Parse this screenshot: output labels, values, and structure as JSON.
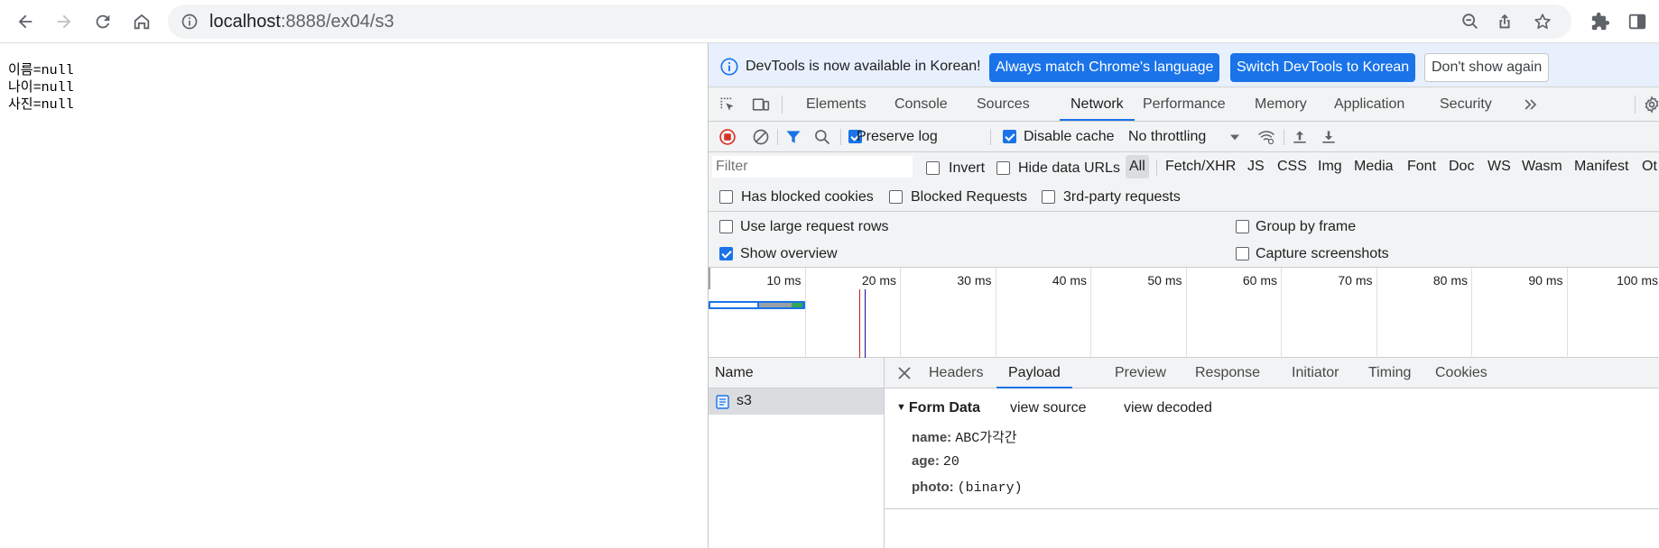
{
  "browser": {
    "url_host": "localhost",
    "url_path": ":8888/ex04/s3"
  },
  "page": {
    "lines": [
      "이름=null",
      "나이=null",
      "사진=null"
    ]
  },
  "devtools": {
    "infobar": {
      "message": "DevTools is now available in Korean!",
      "btn_match": "Always match Chrome's language",
      "btn_switch": "Switch DevTools to Korean",
      "btn_dismiss": "Don't show again"
    },
    "tabs": [
      "Elements",
      "Console",
      "Sources",
      "Network",
      "Performance",
      "Memory",
      "Application",
      "Security"
    ],
    "active_tab": "Network",
    "toolbar": {
      "preserve_log": "Preserve log",
      "disable_cache": "Disable cache",
      "throttling": "No throttling"
    },
    "filter": {
      "placeholder": "Filter",
      "invert": "Invert",
      "hide_data_urls": "Hide data URLs",
      "types": [
        "All",
        "Fetch/XHR",
        "JS",
        "CSS",
        "Img",
        "Media",
        "Font",
        "Doc",
        "WS",
        "Wasm",
        "Manifest",
        "Ot"
      ],
      "active_type": "All",
      "has_blocked_cookies": "Has blocked cookies",
      "blocked_requests": "Blocked Requests",
      "third_party": "3rd-party requests"
    },
    "settings": {
      "large_rows": "Use large request rows",
      "group_by_frame": "Group by frame",
      "show_overview": "Show overview",
      "capture_screenshots": "Capture screenshots"
    },
    "overview": {
      "ticks": [
        "10 ms",
        "20 ms",
        "30 ms",
        "40 ms",
        "50 ms",
        "60 ms",
        "70 ms",
        "80 ms",
        "90 ms",
        "100 ms"
      ],
      "dom_content_loaded_ms": 19.3,
      "load_ms": 19.9
    },
    "requests": {
      "header": "Name",
      "rows": [
        {
          "name": "s3"
        }
      ]
    },
    "detail": {
      "tabs": [
        "Headers",
        "Payload",
        "Preview",
        "Response",
        "Initiator",
        "Timing",
        "Cookies"
      ],
      "active_tab": "Payload",
      "section_title": "Form Data",
      "view_source": "view source",
      "view_decoded": "view decoded",
      "form": [
        {
          "key": "name:",
          "value": "ABC가각간"
        },
        {
          "key": "age:",
          "value": "20"
        },
        {
          "key": "photo:",
          "value": "(binary)"
        }
      ]
    },
    "colors": {
      "accent": "#1a73e8",
      "record": "#d93025"
    }
  }
}
